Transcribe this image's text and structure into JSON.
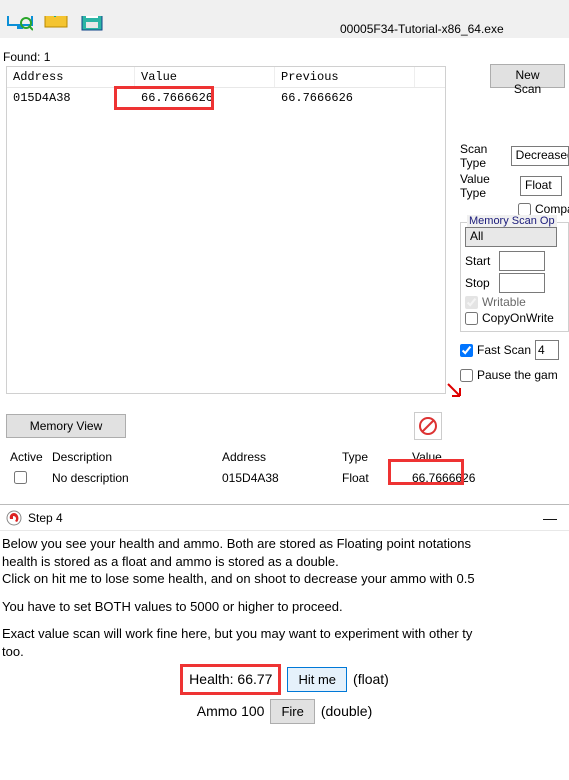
{
  "menu_hint": "",
  "target_exe": "00005F34-Tutorial-x86_64.exe",
  "found_label": "Found: 1",
  "results": {
    "headers": {
      "address": "Address",
      "value": "Value",
      "previous": "Previous"
    },
    "row": {
      "address": "015D4A38",
      "value": "66.7666626",
      "previous": "66.7666626"
    }
  },
  "buttons": {
    "new_scan": "New Scan",
    "memory_view": "Memory View"
  },
  "scan": {
    "scan_type_label": "Scan Type",
    "scan_type_value": "Decreased",
    "value_type_label": "Value Type",
    "value_type_value": "Float",
    "compare_label": "Compa",
    "memory_group_label": "Memory Scan Op",
    "all_label": "All",
    "start_label": "Start",
    "stop_label": "Stop",
    "writable_label": "Writable",
    "copyonwrite_label": "CopyOnWrite",
    "fast_scan_label": "Fast Scan",
    "fast_scan_value": "4",
    "pause_label": "Pause the gam"
  },
  "addrlist": {
    "headers": {
      "active": "Active",
      "description": "Description",
      "address": "Address",
      "type": "Type",
      "value": "Value"
    },
    "row": {
      "description": "No description",
      "address": "015D4A38",
      "type": "Float",
      "value": "66.7666626"
    }
  },
  "tutorial": {
    "title": "Step 4",
    "body_l1": "Below you see your health and ammo. Both are stored as Floating point notations",
    "body_l2": "health is stored as a float and ammo is stored as a double.",
    "body_l3": "Click on hit me to lose some health, and on shoot to decrease your ammo with 0.5",
    "body_l4": "You have to set BOTH values to 5000 or higher to proceed.",
    "body_l5": "Exact value scan will work fine here, but you may want to experiment with other ty",
    "body_l6": "too.",
    "health_label": "Health: 66.77",
    "hit_me": "Hit me",
    "float_note": "(float)",
    "ammo_label": "Ammo 100",
    "fire": "Fire",
    "double_note": "(double)",
    "minimize": "—"
  }
}
